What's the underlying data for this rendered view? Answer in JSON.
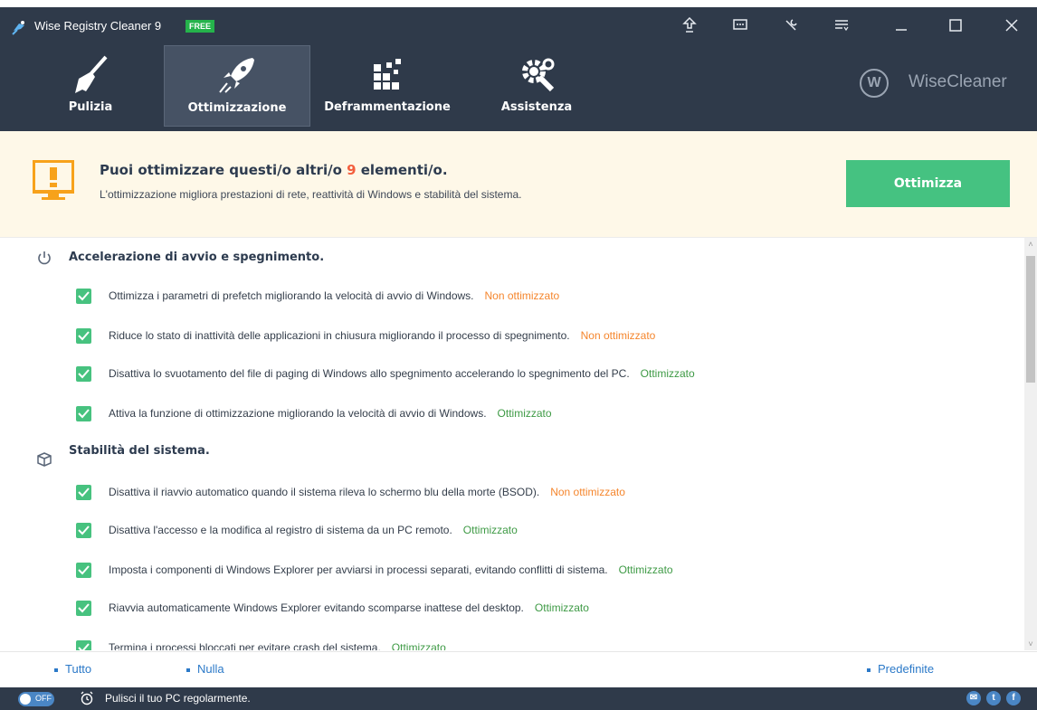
{
  "window": {
    "title": "Wise Registry Cleaner 9",
    "badge": "FREE",
    "buttons": [
      "upgrade-icon",
      "feedback-icon",
      "tools-icon",
      "menu-icon",
      "minimize-icon",
      "maximize-icon",
      "close-icon"
    ]
  },
  "tabs": [
    {
      "label": "Pulizia",
      "icon": "broom-icon"
    },
    {
      "label": "Ottimizzazione",
      "icon": "rocket-icon",
      "active": true
    },
    {
      "label": "Deframmentazione",
      "icon": "defrag-icon"
    },
    {
      "label": "Assistenza",
      "icon": "gears-icon"
    }
  ],
  "brand": {
    "logo_letter": "W",
    "name": "WiseCleaner"
  },
  "banner": {
    "title_prefix": "Puoi ottimizzare questi/o altri/o ",
    "count": "9",
    "title_suffix": " elementi/o.",
    "subtitle": "L'ottimizzazione migliora prestazioni di rete, reattività di Windows e stabilità del sistema.",
    "button_label": "Ottimizza"
  },
  "sections": [
    {
      "title": "Accelerazione di avvio e spegnimento.",
      "icon": "power-icon",
      "items": [
        {
          "text": "Ottimizza i parametri di prefetch migliorando la velocità di avvio di Windows.",
          "status": "Non ottimizzato",
          "checked": true
        },
        {
          "text": "Riduce lo stato di inattività delle applicazioni in chiusura migliorando il processo di spegnimento.",
          "status": "Non ottimizzato",
          "checked": true
        },
        {
          "text": "Disattiva lo svuotamento del file di paging di Windows allo spegnimento accelerando lo spegnimento del PC.",
          "status": "Ottimizzato",
          "checked": true
        },
        {
          "text": "Attiva la funzione di ottimizzazione migliorando la velocità di avvio di Windows.",
          "status": "Ottimizzato",
          "checked": true
        }
      ]
    },
    {
      "title": "Stabilità del sistema.",
      "icon": "cube-icon",
      "items": [
        {
          "text": "Disattiva il riavvio automatico quando il sistema rileva lo schermo blu della morte (BSOD).",
          "status": "Non ottimizzato",
          "checked": true
        },
        {
          "text": "Disattiva l'accesso e la modifica al registro di sistema da un PC remoto.",
          "status": "Ottimizzato",
          "checked": true
        },
        {
          "text": "Imposta i componenti di Windows Explorer per avviarsi in processi separati, evitando conflitti di sistema.",
          "status": "Ottimizzato",
          "checked": true
        },
        {
          "text": "Riavvia automaticamente Windows Explorer evitando scomparse inattese del desktop.",
          "status": "Ottimizzato",
          "checked": true
        },
        {
          "text": "Termina i processi bloccati per evitare crash del sistema.",
          "status": "Ottimizzato",
          "checked": true
        }
      ]
    }
  ],
  "footer": {
    "select_all": "Tutto",
    "select_none": "Nulla",
    "defaults": "Predefinite"
  },
  "statusbar": {
    "toggle_label": "OFF",
    "text": "Pulisci il tuo PC regolarmente.",
    "social": [
      "mail-icon",
      "twitter-icon",
      "facebook-icon"
    ]
  },
  "colors": {
    "header_bg": "#2f3a4a",
    "accent_green": "#45c281",
    "status_bad": "#f5862d",
    "status_good": "#3e9a45",
    "count_red": "#f35e3d",
    "link_blue": "#2b79c8"
  }
}
